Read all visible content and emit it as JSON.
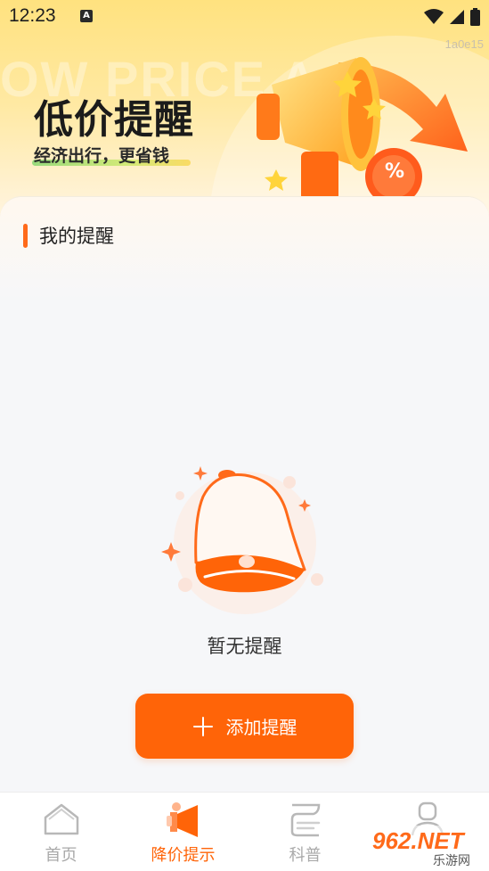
{
  "status_bar": {
    "time": "12:23",
    "notification_icon": "a-icon",
    "signal_icons": [
      "wifi-icon",
      "cell-signal-icon",
      "battery-icon"
    ]
  },
  "header": {
    "build_id": "1a0e15",
    "watermark": "OW PRICE A",
    "title": "低价提醒",
    "subtitle": "经济出行，更省钱",
    "hero_badge": "%"
  },
  "reminders": {
    "section_title": "我的提醒",
    "empty_text": "暂无提醒",
    "add_button_label": "添加提醒"
  },
  "bottom_nav": {
    "items": [
      {
        "label": "首页",
        "icon": "home-icon",
        "active": false
      },
      {
        "label": "降价提示",
        "icon": "megaphone-icon",
        "active": true
      },
      {
        "label": "科普",
        "icon": "book-icon",
        "active": false
      },
      {
        "label": "",
        "icon": "profile-icon",
        "active": false
      }
    ]
  },
  "watermark_logo": {
    "text": "962.NET",
    "subtext": "乐游网"
  },
  "colors": {
    "accent": "#ff6408",
    "banner_yellow": "#ffe27f",
    "inactive_nav": "#a9a9a9"
  }
}
